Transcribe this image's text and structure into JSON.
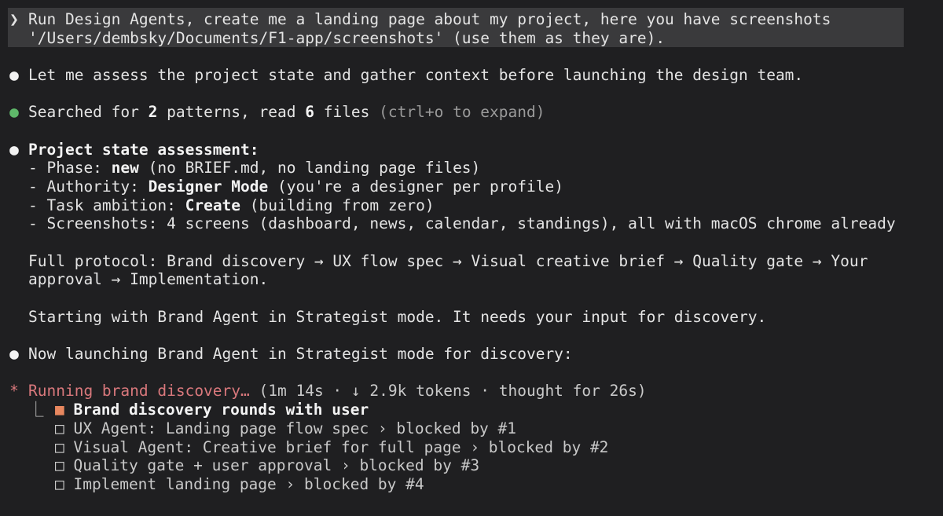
{
  "prompt": {
    "chevron": "❯",
    "line1": "Run Design Agents, create me a landing page about my project, here you have screenshots",
    "line2": "'/Users/dembsky/Documents/F1-app/screenshots' (use them as they are)."
  },
  "messages": {
    "assess": "Let me assess the project state and gather context before launching the design team.",
    "searched_prefix": "Searched for ",
    "searched_count1": "2",
    "searched_mid": " patterns, read ",
    "searched_count2": "6",
    "searched_suffix": " files ",
    "searched_hint": "(ctrl+o to expand)",
    "assessment_title": "Project state assessment:",
    "phase_prefix": "- Phase: ",
    "phase_value": "new",
    "phase_suffix": " (no BRIEF.md, no landing page files)",
    "authority_prefix": "- Authority: ",
    "authority_value": "Designer Mode",
    "authority_suffix": " (you're a designer per profile)",
    "task_prefix": "- Task ambition: ",
    "task_value": "Create",
    "task_suffix": " (building from zero)",
    "screenshots_line": "- Screenshots: 4 screens (dashboard, news, calendar, standings), all with macOS chrome already",
    "protocol_line1": "Full protocol: Brand discovery → UX flow spec → Visual creative brief → Quality gate → Your",
    "protocol_line2": "approval → Implementation.",
    "starting_line": "Starting with Brand Agent in Strategist mode. It needs your input for discovery.",
    "launching_line": "Now launching Brand Agent in Strategist mode for discovery:"
  },
  "status": {
    "spinner": "*",
    "running_label": "Running brand discovery…",
    "details": " (1m 14s · ↓ 2.9k tokens · thought for 26s)"
  },
  "todos": {
    "tree": "⎿",
    "active_box": "■",
    "pending_box": "□",
    "items": [
      {
        "label": "Brand discovery rounds with user"
      },
      {
        "label": "UX Agent: Landing page flow spec › blocked by #1"
      },
      {
        "label": "Visual Agent: Creative brief for full page › blocked by #2"
      },
      {
        "label": "Quality gate + user approval › blocked by #3"
      },
      {
        "label": "Implement landing page › blocked by #4"
      }
    ]
  },
  "bullets": {
    "dot": "●"
  },
  "colors": {
    "background": "#1f1f21",
    "prompt_box": "#3a3a3c",
    "green": "#5fb86a",
    "running": "#d9787c",
    "active_todo": "#e7875f"
  }
}
